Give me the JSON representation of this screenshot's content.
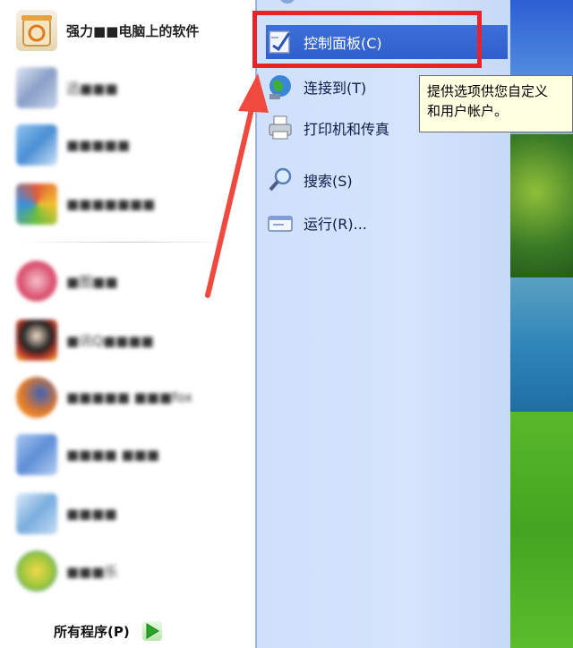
{
  "pinned_programs": [
    {
      "label": "强力■■电脑上的软件",
      "blurred": false,
      "icon": "recycle-bin-icon",
      "color": "#e9a23b"
    },
    {
      "label": "迅■■■",
      "blurred": true,
      "icon": "document-icon",
      "color": "#8aa0c8"
    },
    {
      "label": "■■■■■",
      "blurred": true,
      "icon": "app-icon",
      "color": "#4b8fd4"
    },
    {
      "label": "■■■■■■■",
      "blurred": true,
      "icon": "colorful-app-icon",
      "color": "#e35a3a"
    }
  ],
  "recent_programs": [
    {
      "label": "■图■■",
      "blurred": true,
      "icon": "image-viewer-icon",
      "color": "#d94b6a"
    },
    {
      "label": "■讯Q■■■■",
      "blurred": true,
      "icon": "qq-penguin-icon",
      "color": "#c23b2a"
    },
    {
      "label": "■■■■■ ■■■fox",
      "blurred": true,
      "icon": "firefox-icon",
      "color": "#e0782b"
    },
    {
      "label": "■■■■ ■■■",
      "blurred": true,
      "icon": "blue-app-icon",
      "color": "#5e8fd8"
    },
    {
      "label": "■■■■",
      "blurred": true,
      "icon": "file-icon",
      "color": "#7aaede"
    },
    {
      "label": "■■■乐",
      "blurred": true,
      "icon": "music-icon",
      "color": "#9ac63a"
    }
  ],
  "all_programs": {
    "label": "所有程序(P)"
  },
  "right_menu": [
    {
      "label": "控制面板(C)",
      "icon": "control-panel-icon",
      "active": true
    },
    {
      "label": "连接到(T)",
      "icon": "globe-network-icon",
      "active": false
    },
    {
      "label": "打印机和传真",
      "icon": "printer-icon",
      "active": false
    },
    {
      "label": "搜索(S)",
      "icon": "search-icon",
      "active": false
    },
    {
      "label": "运行(R)...",
      "icon": "run-icon",
      "active": false
    }
  ],
  "tooltip": {
    "line1": "提供选项供您自定义",
    "line2": "和用户帐户。"
  },
  "colors": {
    "highlight_box": "#e8242a",
    "arrow": "#f04a3f",
    "active_item": "#316ac5",
    "tooltip_bg": "#ffffe1"
  }
}
